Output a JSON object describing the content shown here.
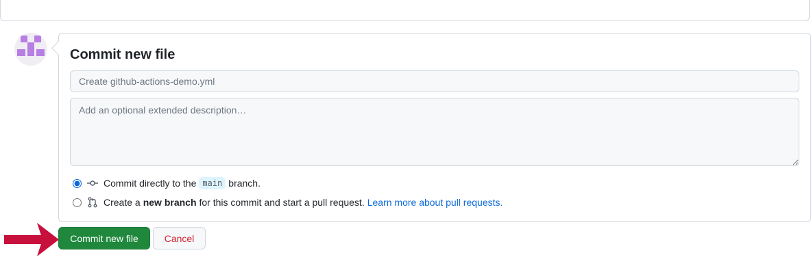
{
  "commit": {
    "title": "Commit new file",
    "summary_placeholder": "Create github-actions-demo.yml",
    "description_placeholder": "Add an optional extended description…",
    "options": [
      {
        "text_before": "Commit directly to the",
        "branch": "main",
        "text_after": "branch.",
        "selected": true
      },
      {
        "text_before": "Create a",
        "bold": "new branch",
        "text_after": "for this commit and start a pull request.",
        "link": "Learn more about pull requests.",
        "selected": false
      }
    ]
  },
  "buttons": {
    "commit_label": "Commit new file",
    "cancel_label": "Cancel"
  },
  "colors": {
    "commit_button": "#1f883d",
    "cancel_text": "#cf222e",
    "link": "#0969da",
    "annotation_arrow": "#c8103c",
    "avatar_identicon": "#b77ee4"
  },
  "icons": {
    "avatar": "identicon-avatar",
    "commit_option": "git-commit-icon",
    "branch_option": "git-pull-request-icon",
    "annotation": "red-arrow-annotation"
  }
}
